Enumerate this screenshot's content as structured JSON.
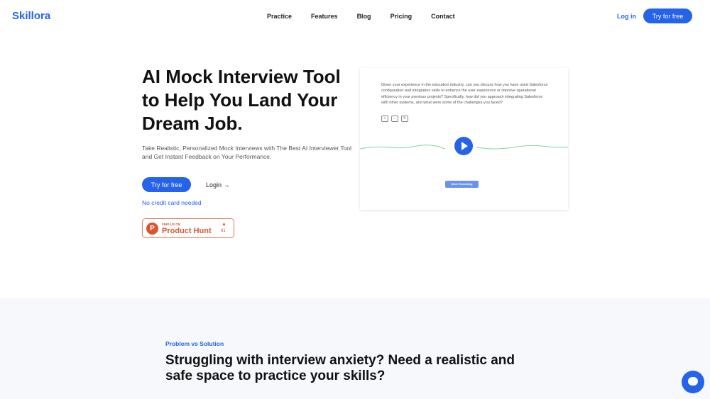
{
  "nav": {
    "logo": "Skillora",
    "links": [
      "Practice",
      "Features",
      "Blog",
      "Pricing",
      "Contact"
    ],
    "login": "Log in",
    "try": "Try for free"
  },
  "hero": {
    "title": "AI Mock Interview Tool to Help You Land Your Dream Job.",
    "subtitle": "Take Realistic, Personalized Mock Interviews with The Best AI Interviewer Tool and Get Instant Feedback on Your Performance.",
    "cta": "Try for free",
    "login": "Login →",
    "note": "No credit card needed",
    "product_hunt": {
      "find": "FIND US ON",
      "name": "Product Hunt",
      "count": "61"
    }
  },
  "demo": {
    "question": "Given your experience in the education industry, can you discuss how you have used Salesforce configuration and integration skills to enhance the user experience or improve operational efficiency in your previous projects? Specifically, how did you approach integrating Salesforce with other systems, and what were some of the challenges you faced?",
    "record": "Start Recording"
  },
  "section": {
    "tag": "Problem vs Solution",
    "title": "Struggling with interview anxiety? Need a realistic and safe space to practice your skills?"
  },
  "colors": {
    "accent": "#2563eb",
    "product_hunt": "#da552f",
    "wave": "#86d3a4"
  }
}
